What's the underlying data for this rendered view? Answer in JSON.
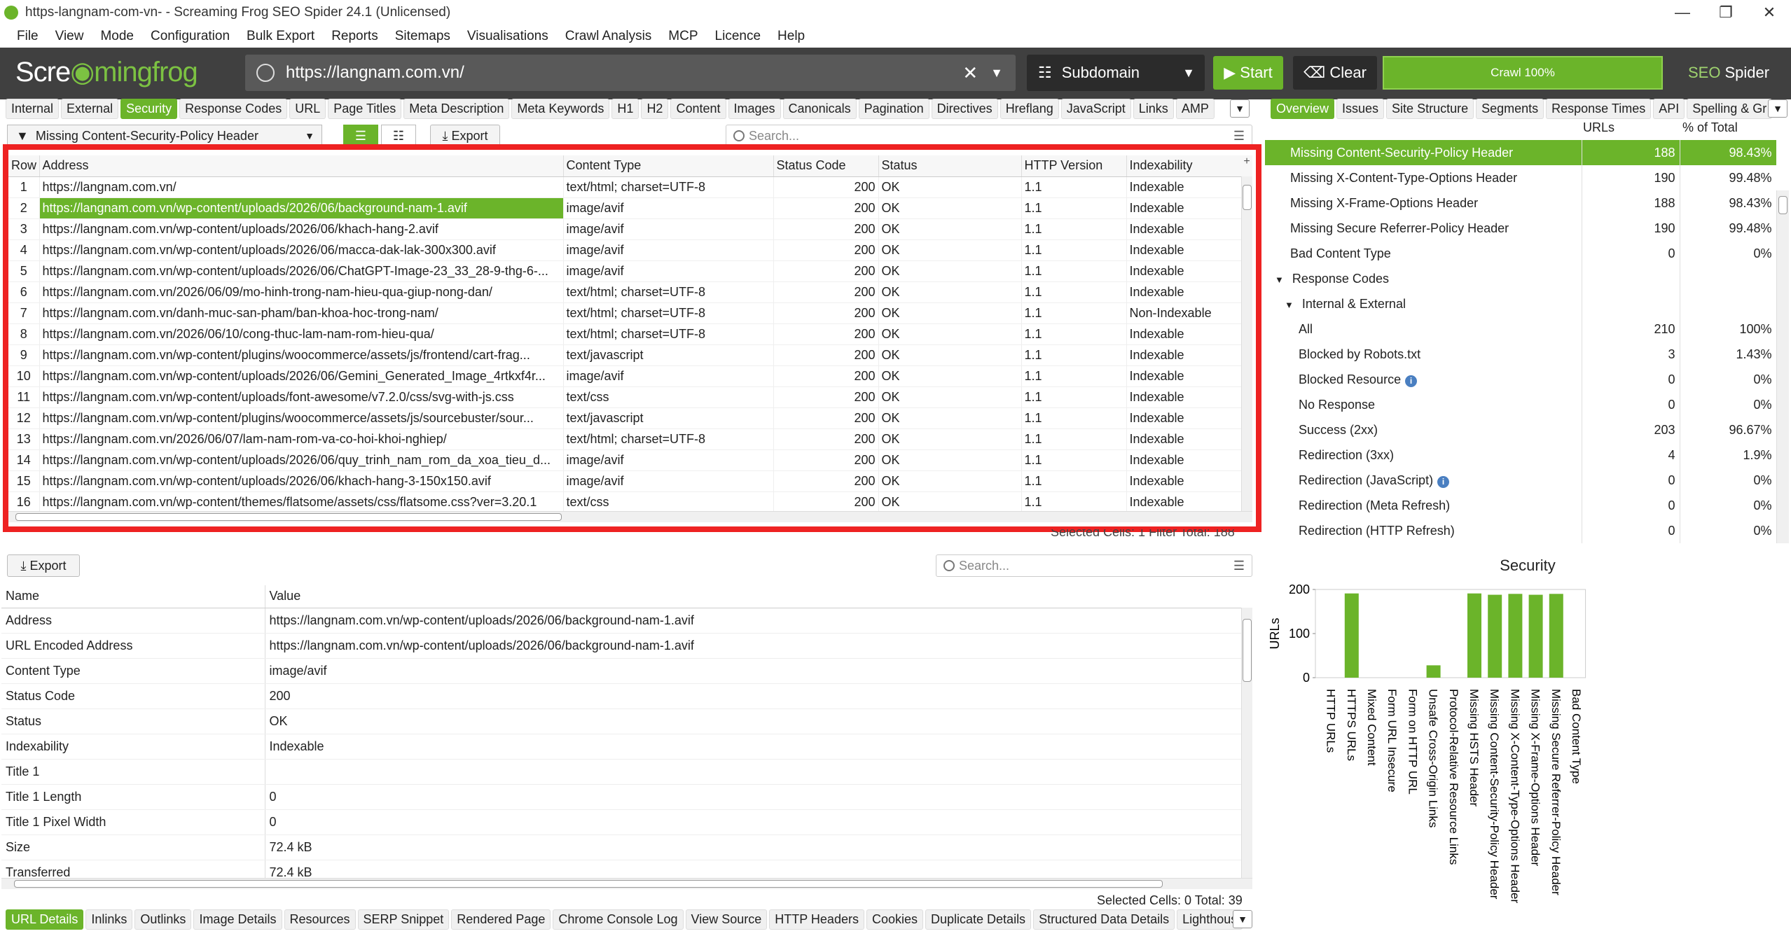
{
  "window": {
    "title": "https-langnam-com-vn- - Screaming Frog SEO Spider 24.1 (Unlicensed)"
  },
  "menu": [
    "File",
    "View",
    "Mode",
    "Configuration",
    "Bulk Export",
    "Reports",
    "Sitemaps",
    "Visualisations",
    "Crawl Analysis",
    "MCP",
    "Licence",
    "Help"
  ],
  "toolbar": {
    "logo_left": "Scre",
    "logo_right": "mingfrog",
    "url": "https://langnam.com.vn/",
    "mode": "Subdomain",
    "start_label": "Start",
    "clear_label": "Clear",
    "progress_label": "Crawl 100%",
    "progress_fraction": 1.0,
    "brand_seo": "SEO",
    "brand_spider": "Spider"
  },
  "main_tabs": [
    "Internal",
    "External",
    "Security",
    "Response Codes",
    "URL",
    "Page Titles",
    "Meta Description",
    "Meta Keywords",
    "H1",
    "H2",
    "Content",
    "Images",
    "Canonicals",
    "Pagination",
    "Directives",
    "Hreflang",
    "JavaScript",
    "Links",
    "AMP"
  ],
  "main_tabs_active": "Security",
  "filter": {
    "label": "Missing Content-Security-Policy Header",
    "export_label": "Export",
    "search_placeholder": "Search..."
  },
  "grid": {
    "headers": [
      "Row",
      "Address",
      "Content Type",
      "Status Code",
      "Status",
      "HTTP Version",
      "Indexability"
    ],
    "rows": [
      [
        "1",
        "https://langnam.com.vn/",
        "text/html; charset=UTF-8",
        "200",
        "OK",
        "1.1",
        "Indexable"
      ],
      [
        "2",
        "https://langnam.com.vn/wp-content/uploads/2026/06/background-nam-1.avif",
        "image/avif",
        "200",
        "OK",
        "1.1",
        "Indexable"
      ],
      [
        "3",
        "https://langnam.com.vn/wp-content/uploads/2026/06/khach-hang-2.avif",
        "image/avif",
        "200",
        "OK",
        "1.1",
        "Indexable"
      ],
      [
        "4",
        "https://langnam.com.vn/wp-content/uploads/2026/06/macca-dak-lak-300x300.avif",
        "image/avif",
        "200",
        "OK",
        "1.1",
        "Indexable"
      ],
      [
        "5",
        "https://langnam.com.vn/wp-content/uploads/2026/06/ChatGPT-Image-23_33_28-9-thg-6-...",
        "image/avif",
        "200",
        "OK",
        "1.1",
        "Indexable"
      ],
      [
        "6",
        "https://langnam.com.vn/2026/06/09/mo-hinh-trong-nam-hieu-qua-giup-nong-dan/",
        "text/html; charset=UTF-8",
        "200",
        "OK",
        "1.1",
        "Indexable"
      ],
      [
        "7",
        "https://langnam.com.vn/danh-muc-san-pham/ban-khoa-hoc-trong-nam/",
        "text/html; charset=UTF-8",
        "200",
        "OK",
        "1.1",
        "Non-Indexable"
      ],
      [
        "8",
        "https://langnam.com.vn/2026/06/10/cong-thuc-lam-nam-rom-hieu-qua/",
        "text/html; charset=UTF-8",
        "200",
        "OK",
        "1.1",
        "Indexable"
      ],
      [
        "9",
        "https://langnam.com.vn/wp-content/plugins/woocommerce/assets/js/frontend/cart-frag...",
        "text/javascript",
        "200",
        "OK",
        "1.1",
        "Indexable"
      ],
      [
        "10",
        "https://langnam.com.vn/wp-content/uploads/2026/06/Gemini_Generated_Image_4rtkxf4r...",
        "image/avif",
        "200",
        "OK",
        "1.1",
        "Indexable"
      ],
      [
        "11",
        "https://langnam.com.vn/wp-content/uploads/font-awesome/v7.2.0/css/svg-with-js.css",
        "text/css",
        "200",
        "OK",
        "1.1",
        "Indexable"
      ],
      [
        "12",
        "https://langnam.com.vn/wp-content/plugins/woocommerce/assets/js/sourcebuster/sour...",
        "text/javascript",
        "200",
        "OK",
        "1.1",
        "Indexable"
      ],
      [
        "13",
        "https://langnam.com.vn/2026/06/07/lam-nam-rom-va-co-hoi-khoi-nghiep/",
        "text/html; charset=UTF-8",
        "200",
        "OK",
        "1.1",
        "Indexable"
      ],
      [
        "14",
        "https://langnam.com.vn/wp-content/uploads/2026/06/quy_trinh_nam_rom_da_xoa_tieu_d...",
        "image/avif",
        "200",
        "OK",
        "1.1",
        "Indexable"
      ],
      [
        "15",
        "https://langnam.com.vn/wp-content/uploads/2026/06/khach-hang-3-150x150.avif",
        "image/avif",
        "200",
        "OK",
        "1.1",
        "Indexable"
      ],
      [
        "16",
        "https://langnam.com.vn/wp-content/themes/flatsome/assets/css/flatsome.css?ver=3.20.1",
        "text/css",
        "200",
        "OK",
        "1.1",
        "Indexable"
      ]
    ],
    "selected_row": 2,
    "status_overlap": "Selected Cells: 1 Filter Total: 188"
  },
  "right_tabs": [
    "Overview",
    "Issues",
    "Site Structure",
    "Segments",
    "Response Times",
    "API",
    "Spelling & Gr"
  ],
  "right_tabs_active": "Overview",
  "overview": {
    "headers": [
      "",
      "URLs",
      "% of Total"
    ],
    "rows": [
      {
        "label": "Missing Content-Security-Policy Header",
        "urls": "188",
        "pct": "98.43%",
        "indent": 1,
        "selected": true
      },
      {
        "label": "Missing X-Content-Type-Options Header",
        "urls": "190",
        "pct": "99.48%",
        "indent": 1
      },
      {
        "label": "Missing X-Frame-Options Header",
        "urls": "188",
        "pct": "98.43%",
        "indent": 1
      },
      {
        "label": "Missing Secure Referrer-Policy Header",
        "urls": "190",
        "pct": "99.48%",
        "indent": 1
      },
      {
        "label": "Bad Content Type",
        "urls": "0",
        "pct": "0%",
        "indent": 1
      },
      {
        "label": "Response Codes",
        "urls": "",
        "pct": "",
        "indent": 0,
        "expander": true
      },
      {
        "label": "Internal & External",
        "urls": "",
        "pct": "",
        "indent": 1,
        "expander": true
      },
      {
        "label": "All",
        "urls": "210",
        "pct": "100%",
        "indent": 2
      },
      {
        "label": "Blocked by Robots.txt",
        "urls": "3",
        "pct": "1.43%",
        "indent": 2
      },
      {
        "label": "Blocked Resource",
        "urls": "0",
        "pct": "0%",
        "indent": 2,
        "info": true
      },
      {
        "label": "No Response",
        "urls": "0",
        "pct": "0%",
        "indent": 2
      },
      {
        "label": "Success (2xx)",
        "urls": "203",
        "pct": "96.67%",
        "indent": 2
      },
      {
        "label": "Redirection (3xx)",
        "urls": "4",
        "pct": "1.9%",
        "indent": 2
      },
      {
        "label": "Redirection (JavaScript)",
        "urls": "0",
        "pct": "0%",
        "indent": 2,
        "info": true
      },
      {
        "label": "Redirection (Meta Refresh)",
        "urls": "0",
        "pct": "0%",
        "indent": 2
      },
      {
        "label": "Redirection (HTTP Refresh)",
        "urls": "0",
        "pct": "0%",
        "indent": 2
      }
    ]
  },
  "details": {
    "export_label": "Export",
    "search_placeholder": "Search...",
    "headers": [
      "Name",
      "Value"
    ],
    "rows": [
      [
        "Address",
        "https://langnam.com.vn/wp-content/uploads/2026/06/background-nam-1.avif"
      ],
      [
        "URL Encoded Address",
        "https://langnam.com.vn/wp-content/uploads/2026/06/background-nam-1.avif"
      ],
      [
        "Content Type",
        "image/avif"
      ],
      [
        "Status Code",
        "200"
      ],
      [
        "Status",
        "OK"
      ],
      [
        "Indexability",
        "Indexable"
      ],
      [
        "Title 1",
        ""
      ],
      [
        "Title 1 Length",
        "0"
      ],
      [
        "Title 1 Pixel Width",
        "0"
      ],
      [
        "Size",
        "72.4 kB"
      ],
      [
        "Transferred",
        "72.4 kB"
      ]
    ],
    "status": "Selected Cells: 0  Total: 39"
  },
  "bottom_tabs": [
    "URL Details",
    "Inlinks",
    "Outlinks",
    "Image Details",
    "Resources",
    "SERP Snippet",
    "Rendered Page",
    "Chrome Console Log",
    "View Source",
    "HTTP Headers",
    "Cookies",
    "Duplicate Details",
    "Structured Data Details",
    "Lighthous"
  ],
  "bottom_tabs_active": "URL Details",
  "colors": {
    "accent": "#6bb42a",
    "toolbar": "#404040",
    "highlight": "#ee2222"
  },
  "chart_data": {
    "type": "bar",
    "title": "Security",
    "ylabel": "URLs",
    "ylim": [
      0,
      200
    ],
    "yticks": [
      "0",
      "100",
      "200"
    ],
    "categories": [
      "HTTP URLs",
      "HTTPS URLs",
      "Mixed Content",
      "Form URL Insecure",
      "Form on HTTP URL",
      "Unsafe Cross-Origin Links",
      "Protocol-Relative Resource Links",
      "Missing HSTS Header",
      "Missing Content-Security-Policy Header",
      "Missing X-Content-Type-Options Header",
      "Missing X-Frame-Options Header",
      "Missing Secure Referrer-Policy Header",
      "Bad Content Type"
    ],
    "values": [
      0,
      191,
      0,
      0,
      0,
      28,
      0,
      191,
      188,
      190,
      188,
      190,
      0
    ],
    "color": "#6bb42a"
  }
}
